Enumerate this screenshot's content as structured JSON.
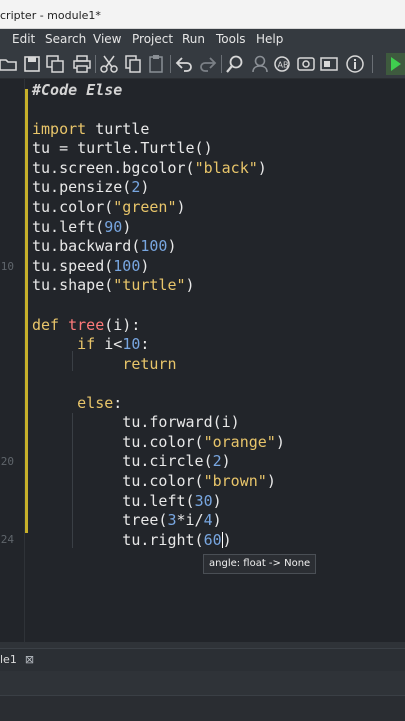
{
  "window": {
    "title": "cripter - module1*"
  },
  "menu": [
    "Edit",
    "Search",
    "View",
    "Project",
    "Run",
    "Tools",
    "Help"
  ],
  "toolbar_icons": [
    "open-icon",
    "save-icon",
    "save-all-icon",
    "print-icon",
    "cut-icon",
    "copy-icon",
    "paste-icon",
    "undo-icon",
    "redo-icon",
    "search-icon",
    "replace-icon",
    "find-in-files-icon",
    "options-icon",
    "layout-icon",
    "info-icon",
    "run-icon"
  ],
  "gutter": {
    "line_numbers": [
      "10",
      "20",
      "24"
    ]
  },
  "code_lines": [
    {
      "t": "#Code Else"
    },
    {
      "t": ""
    },
    {
      "t": "import turtle"
    },
    {
      "t": "tu = turtle.Turtle()"
    },
    {
      "t": "tu.screen.bgcolor(\"black\")"
    },
    {
      "t": "tu.pensize(2)"
    },
    {
      "t": "tu.color(\"green\")"
    },
    {
      "t": "tu.left(90)"
    },
    {
      "t": "tu.backward(100)"
    },
    {
      "t": "tu.speed(100)"
    },
    {
      "t": "tu.shape(\"turtle\")"
    },
    {
      "t": ""
    },
    {
      "t": "def tree(i):"
    },
    {
      "t": "    if i<10:"
    },
    {
      "t": "        return"
    },
    {
      "t": ""
    },
    {
      "t": "    else:"
    },
    {
      "t": "        tu.forward(i)"
    },
    {
      "t": "        tu.color(\"orange\")"
    },
    {
      "t": "        tu.circle(2)"
    },
    {
      "t": "        tu.color(\"brown\")"
    },
    {
      "t": "        tu.left(30)"
    },
    {
      "t": "        tree(3*i/4)"
    },
    {
      "t": "        tu.right(60)"
    }
  ],
  "tooltip": {
    "text": "angle: float -> None"
  },
  "tab": {
    "label": "le1",
    "close": "⊠"
  },
  "colors": {
    "background": "#22252a",
    "keyword": "#e8c56a",
    "number": "#78a6e0",
    "function_name": "#ff7a7a",
    "fold_marker": "#c7b02a"
  }
}
